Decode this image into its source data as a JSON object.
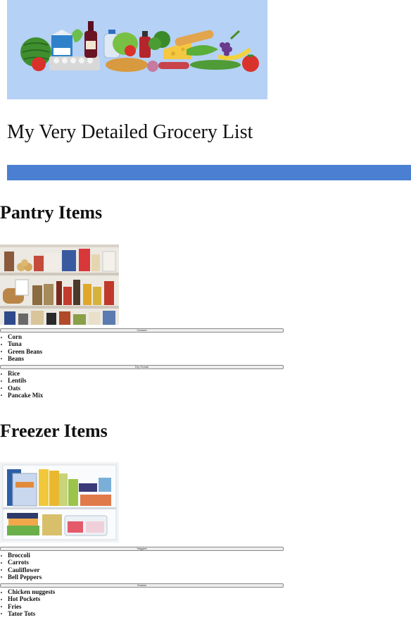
{
  "page": {
    "title": "My Very Detailed Grocery List"
  },
  "banner": {
    "icon": "groceries-illustration"
  },
  "colors": {
    "banner_bg": "#b5d1f5",
    "divider_bar": "#4a7fd1"
  },
  "sections": {
    "pantry": {
      "title": "Pantry Items",
      "photo_icon": "pantry-shelves-photo",
      "groups": [
        {
          "label": "Canned",
          "items": [
            "Corn",
            "Tuna",
            "Green Beans",
            "Beans"
          ]
        },
        {
          "label": "Dry Goods",
          "items": [
            "Rice",
            "Lentils",
            "Oats",
            "Pancake Mix"
          ]
        }
      ]
    },
    "freezer": {
      "title": "Freezer Items",
      "photo_icon": "freezer-photo",
      "groups": [
        {
          "label": "Veggies",
          "items": [
            "Broccoli",
            "Carrots",
            "Cauliflower",
            "Bell Peppers"
          ]
        },
        {
          "label": "Snacks",
          "items": [
            "Chicken nuggests",
            "Hot Pockets",
            "Fries",
            "Tator Tots"
          ]
        }
      ]
    }
  }
}
